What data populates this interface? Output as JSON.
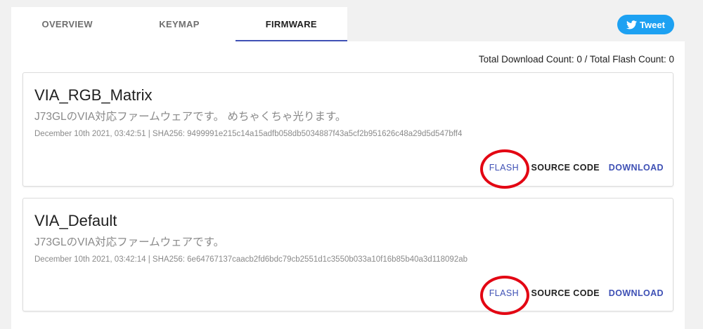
{
  "tabs": [
    {
      "label": "OVERVIEW"
    },
    {
      "label": "KEYMAP"
    },
    {
      "label": "FIRMWARE"
    }
  ],
  "tweet": {
    "label": "Tweet"
  },
  "counts": {
    "text": "Total Download Count: 0 / Total Flash Count: 0"
  },
  "firmwares": [
    {
      "name": "VIA_RGB_Matrix",
      "description": "J73GLのVIA対応ファームウェアです。 めちゃくちゃ光ります。",
      "meta": "December 10th 2021, 03:42:51 | SHA256: 9499991e215c14a15adfb058db5034887f43a5cf2b951626c48a29d5d547bff4",
      "flash_label": "FLASH",
      "source_label": "SOURCE CODE",
      "download_label": "DOWNLOAD"
    },
    {
      "name": "VIA_Default",
      "description": "J73GLのVIA対応ファームウェアです。",
      "meta": "December 10th 2021, 03:42:14 | SHA256: 6e64767137caacb2fd6bdc79cb2551d1c3550b033a10f16b85b40a3d118092ab",
      "flash_label": "FLASH",
      "source_label": "SOURCE CODE",
      "download_label": "DOWNLOAD"
    }
  ],
  "colors": {
    "accent": "#3f51b5",
    "tweet": "#1da1f2",
    "highlight_circle": "#e30613"
  }
}
